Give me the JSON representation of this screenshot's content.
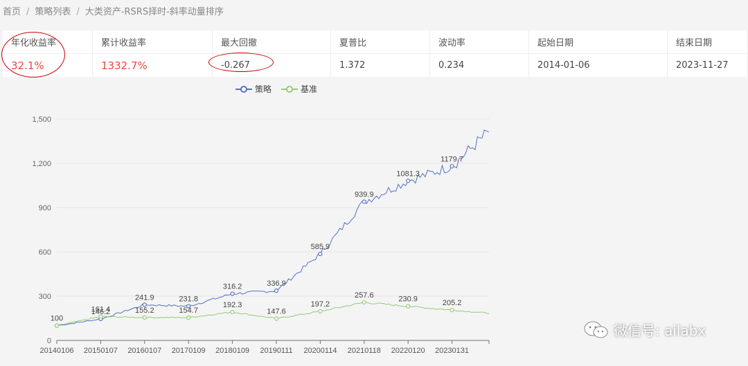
{
  "breadcrumb": [
    "首页",
    "策略列表",
    "大类资产-RSRS择时-斜率动量排序"
  ],
  "stats": {
    "headers": [
      "年化收益率",
      "累计收益率",
      "最大回撤",
      "夏普比",
      "波动率",
      "起始日期",
      "结束日期"
    ],
    "values": [
      "32.1%",
      "1332.7%",
      "-0.267",
      "1.372",
      "0.234",
      "2014-01-06",
      "2023-11-27"
    ]
  },
  "legend": [
    "策略",
    "基准"
  ],
  "watermark": "微信号: ailabx",
  "colors": {
    "strategy": "#5470c6",
    "benchmark": "#91cc75",
    "highlight": "#e8483d",
    "annotation": "#c80000"
  },
  "chart_data": {
    "type": "line",
    "x": [
      "20140106",
      "20150107",
      "20160107",
      "20170109",
      "20180109",
      "20190111",
      "20200114",
      "20210118",
      "20220120",
      "20230131"
    ],
    "ylim": [
      0,
      1500
    ],
    "yticks": [
      0,
      300,
      600,
      900,
      1200,
      1500
    ],
    "ytick_labels": [
      "0",
      "300",
      "600",
      "900",
      "1,200",
      "1,500"
    ],
    "series": [
      {
        "name": "策略",
        "values": [
          100,
          145,
          241.9,
          231.8,
          316.2,
          336.9,
          585.9,
          939.9,
          1081.3,
          1179.7
        ],
        "labels": [
          "",
          "146.2",
          "241.9",
          "231.8",
          "316.2",
          "336.9",
          "585.9",
          "939.9",
          "1081.3",
          "1179.7"
        ]
      },
      {
        "name": "基准",
        "values": [
          100,
          161.4,
          155.2,
          154.7,
          192.3,
          147.6,
          197.2,
          257.6,
          230.9,
          205.2
        ],
        "labels": [
          "100",
          "161.4",
          "155.2",
          "154.7",
          "192.3",
          "147.6",
          "197.2",
          "257.6",
          "230.9",
          "205.2"
        ]
      }
    ]
  }
}
